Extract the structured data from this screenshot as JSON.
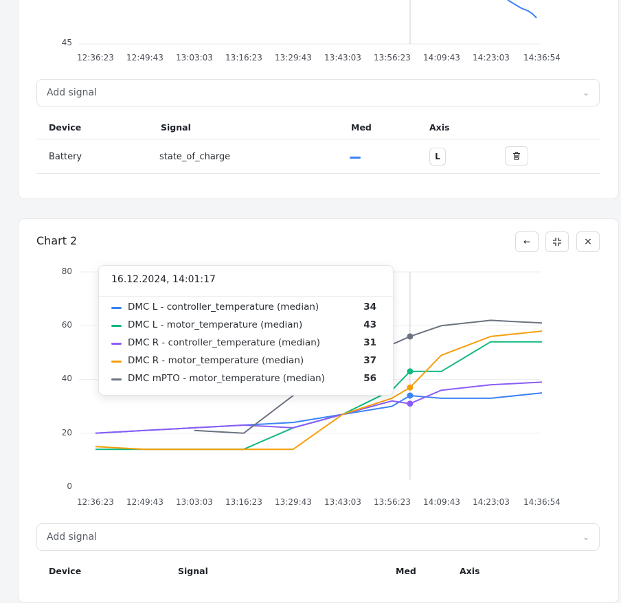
{
  "chart1": {
    "y_tick": "45",
    "x_ticks": [
      "12:36:23",
      "12:49:43",
      "13:03:03",
      "13:16:23",
      "13:29:43",
      "13:43:03",
      "13:56:23",
      "14:09:43",
      "14:23:03",
      "14:36:54"
    ],
    "add_signal_placeholder": "Add signal",
    "table": {
      "headers": {
        "device": "Device",
        "signal": "Signal",
        "med": "Med",
        "axis": "Axis"
      },
      "rows": [
        {
          "device": "Battery",
          "signal": "state_of_charge",
          "axis": "L",
          "med_color": "#3b82f6"
        }
      ]
    }
  },
  "chart2": {
    "title": "Chart 2",
    "toolbar": {
      "back_icon": "arrow-left-icon",
      "collapse_icon": "collapse-icon",
      "close_icon": "close-icon"
    },
    "x_ticks": [
      "12:36:23",
      "12:49:43",
      "13:03:03",
      "13:16:23",
      "13:29:43",
      "13:43:03",
      "13:56:23",
      "14:09:43",
      "14:23:03",
      "14:36:54"
    ],
    "y_ticks": [
      "0",
      "20",
      "40",
      "60",
      "80"
    ],
    "tooltip": {
      "title": "16.12.2024, 14:01:17",
      "rows": [
        {
          "label": "DMC L - controller_temperature (median)",
          "value": "34",
          "color": "#3b82f6"
        },
        {
          "label": "DMC L - motor_temperature (median)",
          "value": "43",
          "color": "#10b981"
        },
        {
          "label": "DMC R - controller_temperature (median)",
          "value": "31",
          "color": "#8b5cf6"
        },
        {
          "label": "DMC R - motor_temperature (median)",
          "value": "37",
          "color": "#f59e0b"
        },
        {
          "label": "DMC mPTO - motor_temperature (median)",
          "value": "56",
          "color": "#6b7280"
        }
      ]
    },
    "add_signal_placeholder": "Add signal",
    "table": {
      "headers": {
        "device": "Device",
        "signal": "Signal",
        "med": "Med",
        "axis": "Axis"
      }
    }
  },
  "chart_data": [
    {
      "type": "line",
      "x": [
        "12:36:23",
        "12:49:43",
        "13:03:03",
        "13:16:23",
        "13:29:43",
        "13:43:03",
        "13:56:23",
        "14:09:43",
        "14:23:03",
        "14:36:54"
      ],
      "series": [
        {
          "values": [
            null,
            null,
            null,
            null,
            null,
            null,
            null,
            null,
            null,
            49
          ]
        }
      ],
      "ylim_visible_min": 45,
      "cursor_x": "14:01:17"
    },
    {
      "type": "line",
      "x": [
        "12:36:23",
        "12:49:43",
        "13:03:03",
        "13:16:23",
        "13:29:43",
        "13:43:03",
        "13:56:23",
        "14:01:17",
        "14:09:43",
        "14:23:03",
        "14:36:54"
      ],
      "ylim": [
        0,
        80
      ],
      "grid": true,
      "cursor_x": "14:01:17",
      "series": [
        {
          "name": "DMC L - controller_temperature (median)",
          "color": "#3b82f6",
          "values": [
            20,
            21,
            22,
            23,
            24,
            27,
            30,
            34,
            33,
            33,
            35
          ]
        },
        {
          "name": "DMC L - motor_temperature (median)",
          "color": "#10b981",
          "values": [
            14,
            14,
            14,
            14,
            22,
            27,
            36,
            43,
            43,
            54,
            54
          ]
        },
        {
          "name": "DMC R - controller_temperature (median)",
          "color": "#8b5cf6",
          "values": [
            20,
            21,
            22,
            23,
            22,
            27,
            32,
            31,
            36,
            38,
            39
          ]
        },
        {
          "name": "DMC R - motor_temperature (median)",
          "color": "#f59e0b",
          "values": [
            15,
            14,
            14,
            14,
            14,
            27,
            33,
            37,
            49,
            56,
            58
          ]
        },
        {
          "name": "DMC mPTO - motor_temperature (median)",
          "color": "#6b7280",
          "values": [
            null,
            null,
            21,
            20,
            34,
            47,
            53,
            56,
            60,
            62,
            61
          ]
        }
      ]
    }
  ]
}
